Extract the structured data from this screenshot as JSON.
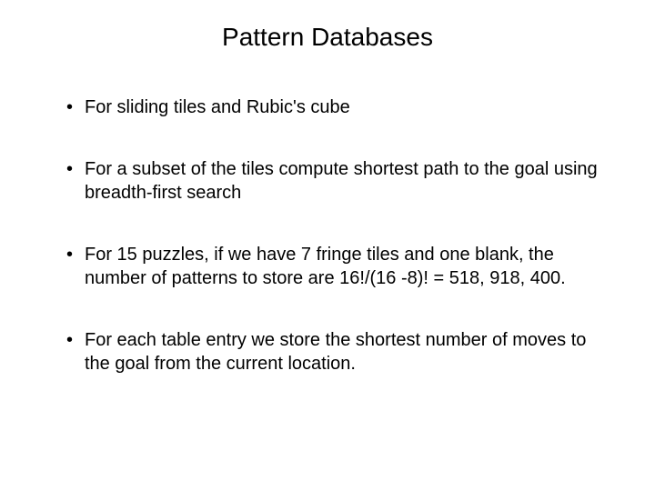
{
  "slide": {
    "title": "Pattern Databases",
    "bullets": [
      "For sliding tiles and Rubic's cube",
      "For a subset of the tiles compute shortest path to the goal using breadth-first search",
      "For 15 puzzles, if we have 7 fringe tiles and one blank, the number of patterns to store are 16!/(16 -8)! = 518, 918, 400.",
      "For each table entry we store the shortest number of moves to the goal from the current location."
    ]
  }
}
